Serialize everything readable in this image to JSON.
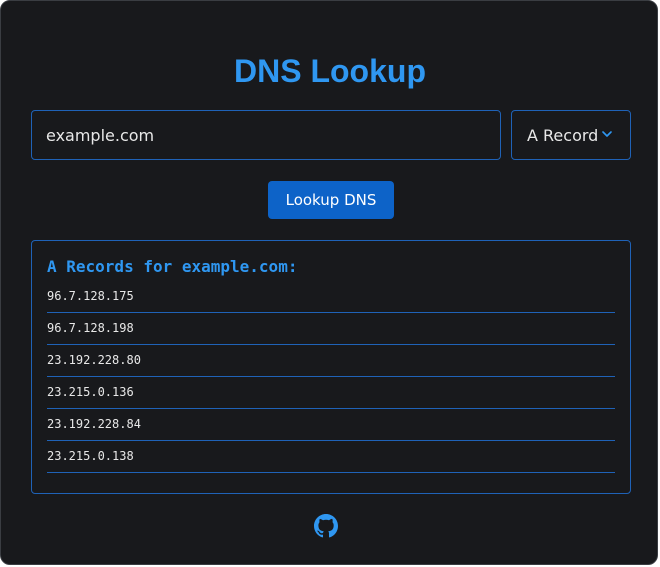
{
  "app": {
    "title": "DNS Lookup"
  },
  "search": {
    "domain_value": "example.com",
    "record_type": "A Record",
    "button_label": "Lookup DNS"
  },
  "results": {
    "heading": "A Records for example.com:",
    "records": [
      "96.7.128.175",
      "96.7.128.198",
      "23.192.228.80",
      "23.215.0.136",
      "23.192.228.84",
      "23.215.0.138"
    ]
  },
  "footer": {
    "icon": "github-icon"
  },
  "colors": {
    "accent": "#2f97f1",
    "button": "#0d63c8",
    "border": "#1f62b7",
    "background": "#18191c",
    "text": "#e8e8e8"
  }
}
